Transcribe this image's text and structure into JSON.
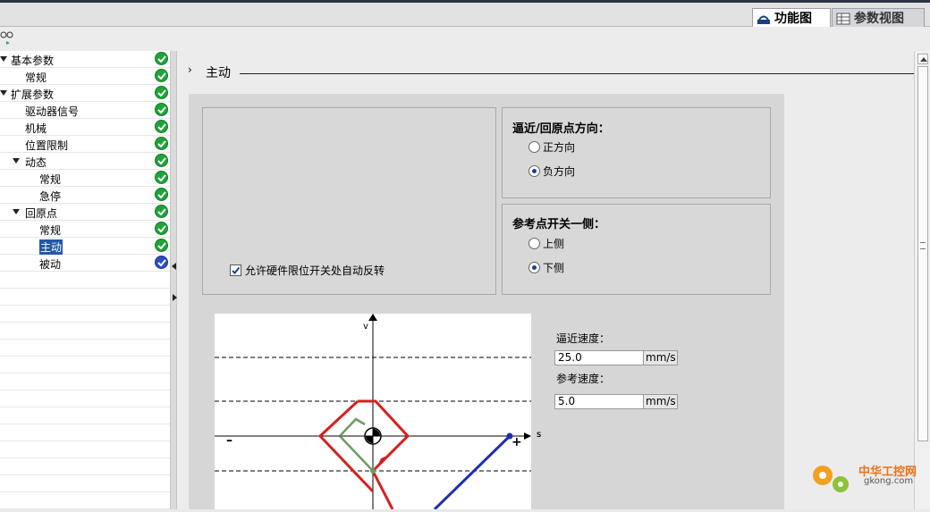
{
  "tabs": {
    "function_view": "功能图",
    "param_view": "参数视图"
  },
  "tree": [
    {
      "label": "基本参数",
      "indent": 0,
      "expanded": true,
      "status": "ok"
    },
    {
      "label": "常规",
      "indent": 1,
      "status": "ok"
    },
    {
      "label": "扩展参数",
      "indent": 0,
      "expanded": true,
      "status": "ok"
    },
    {
      "label": "驱动器信号",
      "indent": 1,
      "status": "ok"
    },
    {
      "label": "机械",
      "indent": 1,
      "status": "ok"
    },
    {
      "label": "位置限制",
      "indent": 1,
      "status": "ok"
    },
    {
      "label": "动态",
      "indent": 1,
      "expanded": true,
      "status": "ok"
    },
    {
      "label": "常规",
      "indent": 2,
      "status": "ok"
    },
    {
      "label": "急停",
      "indent": 2,
      "status": "ok"
    },
    {
      "label": "回原点",
      "indent": 1,
      "expanded": true,
      "status": "ok"
    },
    {
      "label": "常规",
      "indent": 2,
      "status": "ok"
    },
    {
      "label": "主动",
      "indent": 2,
      "status": "ok",
      "selected": true
    },
    {
      "label": "被动",
      "indent": 2,
      "status": "info"
    }
  ],
  "section": {
    "title": "主动"
  },
  "approach_direction": {
    "title": "逼近/回原点方向：",
    "options": [
      "正方向",
      "负方向"
    ],
    "selected": "负方向"
  },
  "ref_switch_side": {
    "title": "参考点开关一侧：",
    "options": [
      "上侧",
      "下侧"
    ],
    "selected": "下侧"
  },
  "auto_reverse": {
    "label": "允许硬件限位开关处自动反转",
    "checked": true
  },
  "speeds": {
    "approach_label": "逼近速度：",
    "approach_value": "25.0",
    "approach_unit": "mm/s",
    "reference_label": "参考速度：",
    "reference_value": "5.0",
    "reference_unit": "mm/s"
  },
  "diagram": {
    "axis_v": "v",
    "axis_s": "s",
    "minus": "–",
    "plus": "+"
  },
  "watermark": {
    "cn": "中华工控网",
    "en": "gkong.com"
  },
  "colors": {
    "status_ok": "#1fa33a",
    "status_info": "#2c4fc4",
    "selection": "#2457a8"
  }
}
